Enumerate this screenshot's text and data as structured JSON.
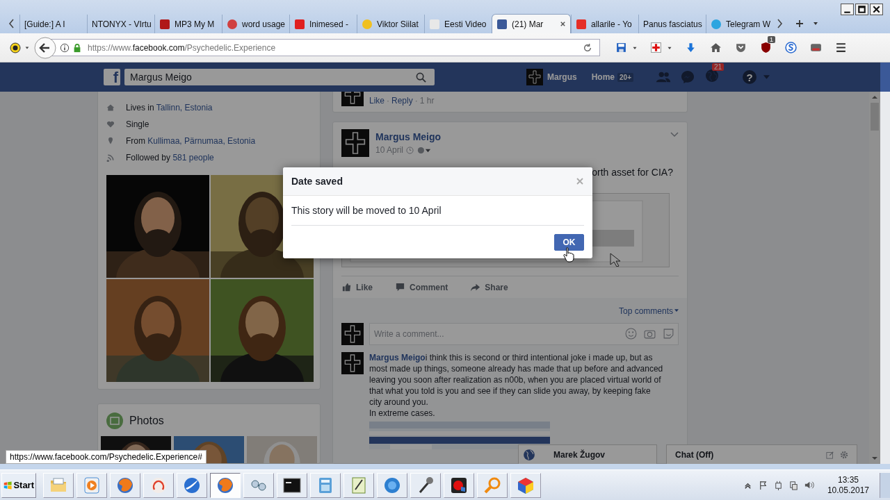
{
  "window": {
    "controls": [
      {
        "kind": "minimize"
      },
      {
        "kind": "maximize"
      },
      {
        "kind": "close"
      }
    ]
  },
  "tabs": [
    {
      "label": "[Guide:] A I",
      "selected": false
    },
    {
      "label": "NTONYX - VIrtu",
      "selected": false
    },
    {
      "label": "MP3 My M",
      "selected": false,
      "icon": {
        "kind": "square",
        "color": "#b01818"
      }
    },
    {
      "label": "word usage",
      "selected": false,
      "icon": {
        "kind": "circle",
        "color": "#d04040"
      }
    },
    {
      "label": "Inimesed -",
      "selected": false,
      "icon": {
        "kind": "square",
        "color": "#e02020"
      }
    },
    {
      "label": "Viktor Siilat",
      "selected": false,
      "icon": {
        "kind": "circle",
        "color": "#f0c020"
      }
    },
    {
      "label": "Eesti Video",
      "selected": false,
      "icon": {
        "kind": "square",
        "color": "#e8e8e8"
      }
    },
    {
      "label": "(21) Mar",
      "selected": true,
      "icon": {
        "kind": "square",
        "color": "#3b5998"
      }
    },
    {
      "label": "allarile - Yo",
      "selected": false,
      "icon": {
        "kind": "square",
        "color": "#e52d27"
      }
    },
    {
      "label": "Panus fasciatus",
      "selected": false
    },
    {
      "label": "Telegram W",
      "selected": false,
      "icon": {
        "kind": "circle",
        "color": "#2ca5e0"
      }
    }
  ],
  "navbar": {
    "url": {
      "prefix": "https://www.",
      "domain": "facebook.com",
      "path": "/Psychedelic.Experience"
    },
    "tools": [
      {
        "kind": "save"
      },
      {
        "kind": "caret"
      },
      {
        "kind": "firstaid"
      },
      {
        "kind": "caret"
      },
      {
        "kind": "download"
      },
      {
        "kind": "home"
      },
      {
        "kind": "pocket"
      },
      {
        "kind": "shield",
        "badge": "1"
      },
      {
        "kind": "swirl"
      },
      {
        "kind": "tv"
      },
      {
        "kind": "menu"
      }
    ]
  },
  "fb_header": {
    "logo": "f",
    "search_value": "Margus Meigo",
    "user": "Margus",
    "home": "Home",
    "home_badge": "20+",
    "notifications_badge": "21",
    "help": "?"
  },
  "intro": {
    "items": [
      {
        "kind": "home",
        "text": "Lives in ",
        "link": "Tallinn, Estonia"
      },
      {
        "kind": "heart",
        "text": "Single"
      },
      {
        "kind": "pin",
        "text": "From ",
        "link": "Kullimaa, Pärnumaa, Estonia"
      },
      {
        "kind": "feed",
        "text": "Followed by ",
        "link": "581 people"
      }
    ],
    "photos": [
      {
        "kind": "picture"
      },
      {
        "kind": "picture"
      },
      {
        "kind": "picture"
      },
      {
        "kind": "picture"
      }
    ]
  },
  "photos_card": {
    "title": "Photos",
    "thumbnails": [
      {
        "kind": "picture"
      },
      {
        "kind": "picture"
      },
      {
        "kind": "picture"
      }
    ]
  },
  "prev_comment": {
    "actions": [
      "Like",
      "Reply"
    ],
    "separator": "·",
    "time": "1 hr"
  },
  "post": {
    "author": "Margus Meigo",
    "date": "10 April",
    "text": "orth asset for CIA?",
    "image": {
      "kind": "picture"
    },
    "actions": [
      {
        "kind": "like",
        "label": "Like"
      },
      {
        "kind": "comment",
        "label": "Comment"
      },
      {
        "kind": "share",
        "label": "Share"
      }
    ],
    "sort": "Top comments",
    "comment_placeholder": "Write a comment...",
    "comment": {
      "author": "Margus Meigo",
      "paragraphs": [
        "i think this is second or third intentional joke i made up, but as most made up things, someone already has made that up before and advanced",
        "leaving you soon after realization as n00b, when you are placed virtual world of that what you told is you and see if they can slide you away, by keeping fake city around you.",
        "In extreme cases."
      ],
      "attachment": {
        "kind": "picture"
      }
    }
  },
  "chat_dock": {
    "contact": "Marek Žugov",
    "chat": "Chat (Off)"
  },
  "dialog": {
    "title": "Date saved",
    "message": "This story will be moved to 10 April",
    "button": "OK"
  },
  "status_url": "https://www.facebook.com/Psychedelic.Experience#",
  "taskbar": {
    "start": "Start",
    "apps": [
      {
        "kind": "folder",
        "selected": false
      },
      {
        "kind": "play",
        "selected": false
      },
      {
        "kind": "globe",
        "selected": false
      },
      {
        "kind": "ring",
        "selected": false
      },
      {
        "kind": "comet",
        "selected": false
      },
      {
        "kind": "globe",
        "selected": true
      },
      {
        "kind": "glasses",
        "selected": false
      },
      {
        "kind": "terminal",
        "selected": false
      },
      {
        "kind": "calculator",
        "selected": false
      },
      {
        "kind": "notepad",
        "selected": false
      },
      {
        "kind": "bubble",
        "selected": false
      },
      {
        "kind": "microphone",
        "selected": false
      },
      {
        "kind": "record",
        "selected": false
      },
      {
        "kind": "magnifier",
        "selected": false
      },
      {
        "kind": "cube",
        "selected": false
      }
    ],
    "tray": [
      {
        "kind": "chevron"
      },
      {
        "kind": "flag"
      },
      {
        "kind": "plug"
      },
      {
        "kind": "network"
      },
      {
        "kind": "speaker"
      }
    ],
    "time": "13:35",
    "date": "10.05.2017"
  }
}
